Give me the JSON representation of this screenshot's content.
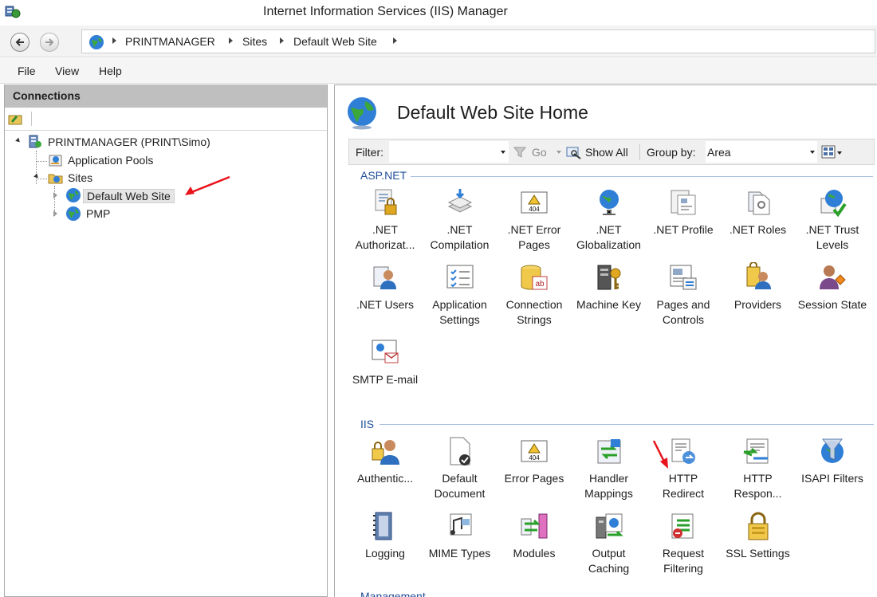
{
  "window": {
    "title": "Internet Information Services (IIS) Manager"
  },
  "address": {
    "crumbs": [
      "PRINTMANAGER",
      "Sites",
      "Default Web Site"
    ]
  },
  "menu": {
    "items": [
      "File",
      "View",
      "Help"
    ]
  },
  "connections": {
    "header": "Connections",
    "tree": {
      "server": "PRINTMANAGER (PRINT\\Simo)",
      "app_pools": "Application Pools",
      "sites": "Sites",
      "site1": "Default Web Site",
      "site2": "PMP"
    }
  },
  "page": {
    "title": "Default Web Site Home"
  },
  "filterbar": {
    "filter_label": "Filter:",
    "go_label": "Go",
    "show_all_label": "Show All",
    "group_by_label": "Group by:",
    "group_by_value": "Area"
  },
  "sections": {
    "aspnet": "ASP.NET",
    "iis": "IIS",
    "management": "Management"
  },
  "aspnet_features": [
    ".NET\nAuthorizat...",
    ".NET\nCompilation",
    ".NET Error\nPages",
    ".NET\nGlobalization",
    ".NET Profile",
    ".NET Roles",
    ".NET Trust\nLevels",
    ".NET Users",
    "Application\nSettings",
    "Connection\nStrings",
    "Machine Key",
    "Pages and\nControls",
    "Providers",
    "Session State",
    "SMTP E-mail"
  ],
  "iis_features": [
    "Authentic...",
    "Default\nDocument",
    "Error Pages",
    "Handler\nMappings",
    "HTTP\nRedirect",
    "HTTP\nRespon...",
    "ISAPI Filters",
    "Logging",
    "MIME Types",
    "Modules",
    "Output\nCaching",
    "Request\nFiltering",
    "SSL Settings"
  ],
  "icons": {
    "app": "iis-manager-icon",
    "globe": "globe-icon",
    "accent_red": "#e8141b",
    "section_blue": "#1f4e97"
  }
}
